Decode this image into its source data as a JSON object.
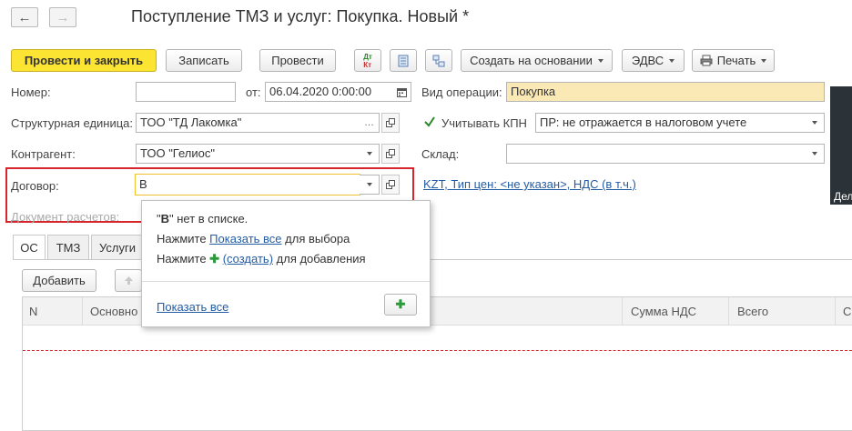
{
  "window": {
    "title": "Поступление ТМЗ и услуг: Покупка. Новый *"
  },
  "nav": {
    "back_glyph": "←",
    "forward_glyph": "→"
  },
  "toolbar": {
    "post_close": "Провести и закрыть",
    "save": "Записать",
    "post": "Провести",
    "dt_label": "Дт",
    "kt_label": "Кт",
    "create_based": "Создать на основании",
    "edvs": "ЭДВС",
    "print": "Печать"
  },
  "form": {
    "number_label": "Номер:",
    "number_value": "",
    "from_label": "от:",
    "date_value": "06.04.2020  0:00:00",
    "operation_label": "Вид операции:",
    "operation_value": "Покупка",
    "unit_label": "Структурная единица:",
    "unit_value": "ТОО \"ТД Лакомка\"",
    "kpn_checkbox_label": "Учитывать КПН",
    "kpn_checked": true,
    "kpn_value": "ПР: не отражается в налоговом учете",
    "counterparty_label": "Контрагент:",
    "counterparty_value": "ТОО \"Гелиос\"",
    "warehouse_label": "Склад:",
    "warehouse_value": "",
    "contract_label": "Договор:",
    "contract_value": "В",
    "price_link": "KZT, Тип цен: <не указан>, НДС (в т.ч.)",
    "settlement_label": "Документ расчетов:",
    "side_panel_text": "Дел"
  },
  "dropdown": {
    "not_found_prefix": "\"",
    "not_found_value": "В",
    "not_found_suffix": "\" нет в списке.",
    "line2_prefix": "Нажмите ",
    "line2_link": "Показать все",
    "line2_suffix": " для выбора",
    "line3_prefix": "Нажмите ",
    "line3_link": "(создать)",
    "line3_suffix": " для добавления",
    "show_all": "Показать все",
    "add_glyph": "✚"
  },
  "tabs": [
    {
      "label": "ОС"
    },
    {
      "label": "ТМЗ"
    },
    {
      "label": "Услуги"
    }
  ],
  "table_toolbar": {
    "add": "Добавить"
  },
  "table": {
    "columns": [
      "N",
      "Основно",
      "Сумма НДС",
      "Всего",
      "С"
    ]
  },
  "colors": {
    "primary_button": "#fbe432",
    "highlight_field": "#fbe9b5",
    "red_frame": "#d7262b",
    "link": "#245ca4",
    "focus_border": "#f2c12e"
  }
}
